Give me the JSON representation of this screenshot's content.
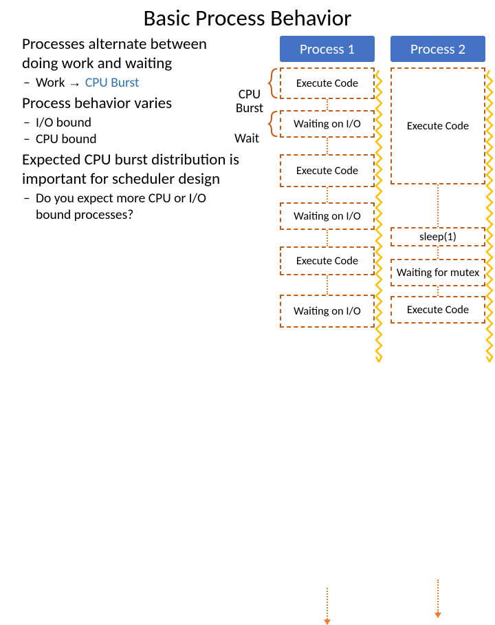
{
  "title": "Basic Process Behavior",
  "bullets": {
    "b1": "Processes alternate between doing work and waiting",
    "b1s1a": "Work ",
    "b1s1b": "CPU Burst",
    "b2": "Process behavior varies",
    "b2s1": "I/O bound",
    "b2s2": "CPU bound",
    "b3": "Expected CPU burst distribution is important for scheduler design",
    "b3s1": "Do you expect more CPU or I/O bound processes?"
  },
  "labels": {
    "cpu": "CPU Burst",
    "wait": "Wait"
  },
  "col1": {
    "header": "Process 1",
    "boxes": [
      "Execute Code",
      "Waiting on I/O",
      "Execute Code",
      "Waiting on I/O",
      "Execute Code",
      "Waiting on I/O"
    ]
  },
  "col2": {
    "header": "Process 2",
    "boxes": [
      "Execute Code",
      "sleep(1)",
      "Waiting for mutex",
      "Execute Code"
    ]
  }
}
